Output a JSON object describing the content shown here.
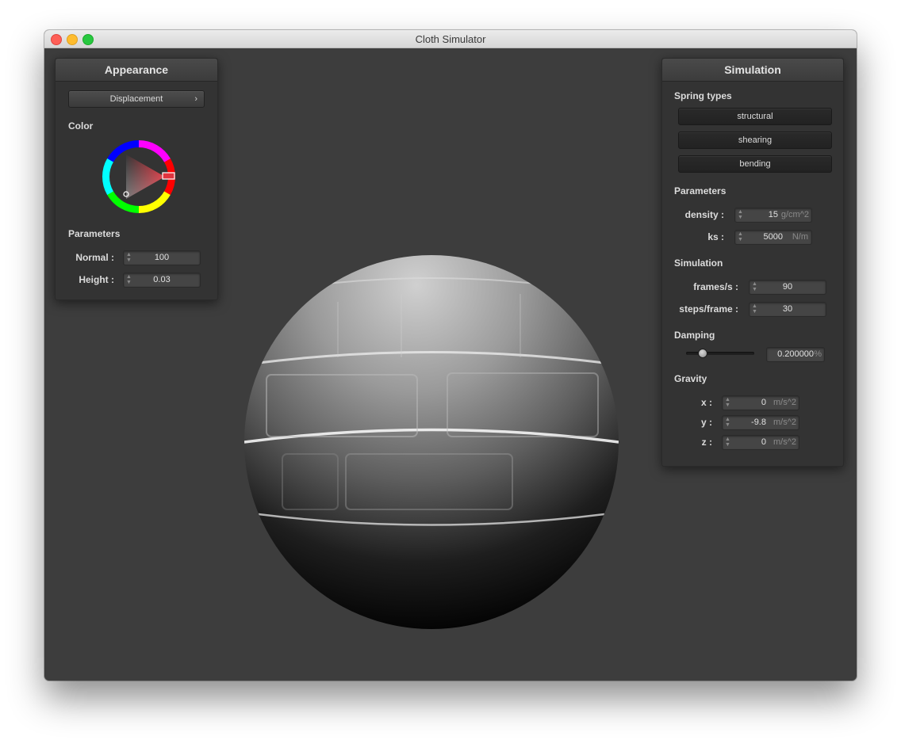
{
  "window": {
    "title": "Cloth Simulator"
  },
  "appearance": {
    "title": "Appearance",
    "shader_selected": "Displacement",
    "color_label": "Color",
    "parameters_label": "Parameters",
    "normal_label": "Normal :",
    "normal_value": "100",
    "height_label": "Height :",
    "height_value": "0.03"
  },
  "simulation": {
    "title": "Simulation",
    "spring_types_label": "Spring types",
    "spring_buttons": [
      "structural",
      "shearing",
      "bending"
    ],
    "parameters_label": "Parameters",
    "density_label": "density :",
    "density_value": "15",
    "density_unit": "g/cm^2",
    "ks_label": "ks :",
    "ks_value": "5000",
    "ks_unit": "N/m",
    "simulation_label": "Simulation",
    "fps_label": "frames/s :",
    "fps_value": "90",
    "steps_label": "steps/frame :",
    "steps_value": "30",
    "damping_label": "Damping",
    "damping_level": 0.2,
    "damping_value": "0.200000",
    "damping_unit": "%",
    "gravity_label": "Gravity",
    "gx_label": "x :",
    "gx_value": "0",
    "gy_label": "y :",
    "gy_value": "-9.8",
    "gz_label": "z :",
    "gz_value": "0",
    "gravity_unit": "m/s^2"
  },
  "colors": {
    "background": "#3d3d3d",
    "panel": "#333333",
    "selected_color": "#e0343f"
  },
  "icons": {
    "close": "close-window-icon",
    "minimize": "minimize-window-icon",
    "zoom": "zoom-window-icon",
    "chevron": "chevron-right-icon",
    "spinner": "spinner-arrows-icon"
  }
}
